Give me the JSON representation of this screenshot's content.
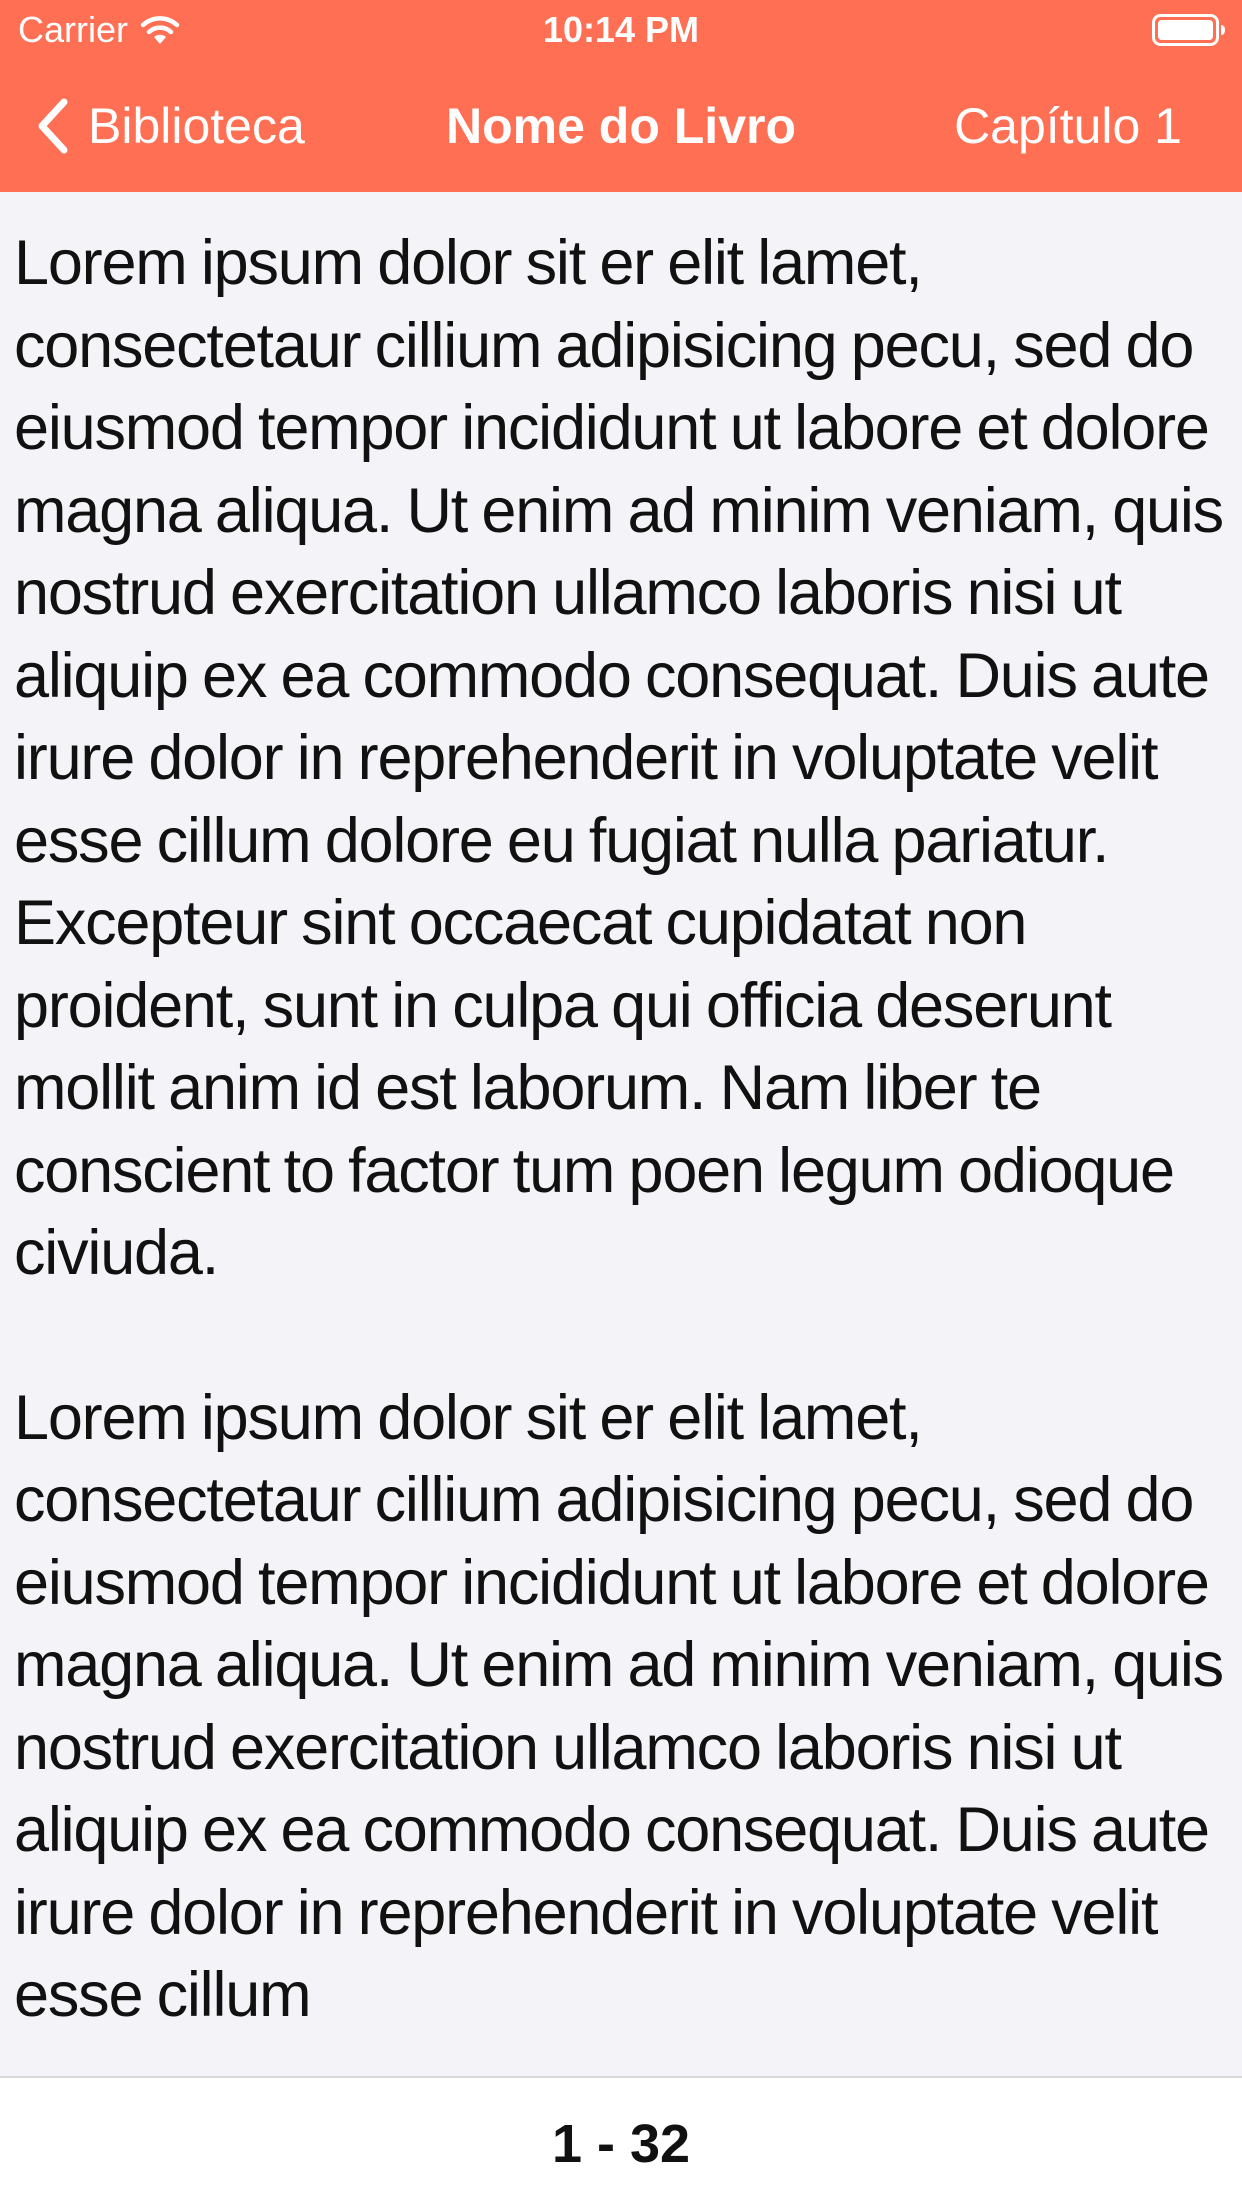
{
  "colors": {
    "header_bg": "#ff6f53",
    "header_text": "#ffffff",
    "content_bg": "#f4f3f8",
    "footer_bg": "#ffffff",
    "text": "#111111"
  },
  "status_bar": {
    "carrier": "Carrier",
    "time": "10:14 PM",
    "wifi_icon": "wifi-icon",
    "battery_icon": "battery-icon"
  },
  "nav": {
    "back_label": "Biblioteca",
    "back_icon": "chevron-left-icon",
    "title": "Nome do Livro",
    "chapter_label": "Capítulo 1"
  },
  "content": {
    "paragraphs": [
      "Lorem ipsum dolor sit er elit lamet, consectetaur cillium adipisicing pecu, sed do eiusmod tempor incididunt ut labore et dolore magna aliqua. Ut enim ad minim veniam, quis nostrud exercitation ullamco laboris nisi ut aliquip ex ea commodo consequat. Duis aute irure dolor in reprehenderit in voluptate velit esse cillum dolore eu fugiat nulla pariatur. Excepteur sint occaecat cupidatat non proident, sunt in culpa qui officia deserunt mollit anim id est laborum. Nam liber te conscient to factor tum poen legum odioque civiuda.",
      "Lorem ipsum dolor sit er elit lamet, consectetaur cillium adipisicing pecu, sed do eiusmod tempor incididunt ut labore et dolore magna aliqua. Ut enim ad minim veniam, quis nostrud exercitation ullamco laboris nisi ut aliquip ex ea commodo consequat. Duis aute irure dolor in reprehenderit in voluptate velit esse cillum"
    ]
  },
  "footer": {
    "page_indicator": "1 - 32"
  }
}
